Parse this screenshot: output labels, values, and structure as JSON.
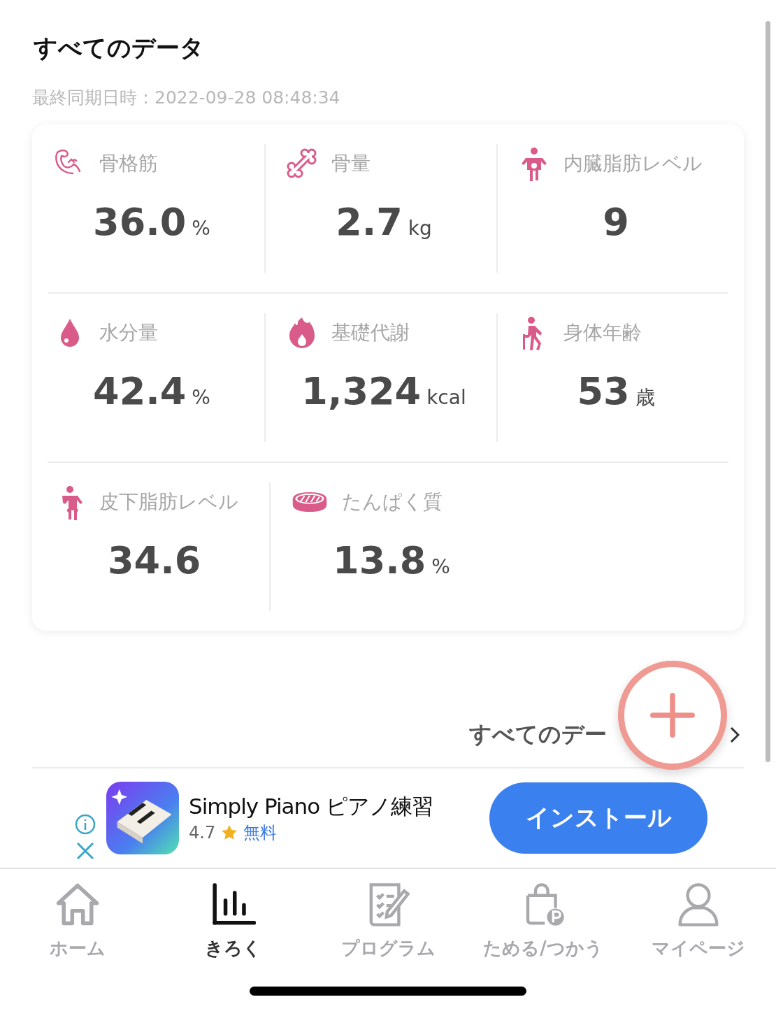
{
  "header": {
    "title": "すべてのデータ",
    "sync": "最終同期日時：2022-09-28 08:48:34"
  },
  "metrics": [
    {
      "kind": "muscle",
      "label": "骨格筋",
      "value": "36.0",
      "unit": "%"
    },
    {
      "kind": "bone",
      "label": "骨量",
      "value": "2.7",
      "unit": "kg"
    },
    {
      "kind": "visceral",
      "label": "内臓脂肪レベル",
      "value": "9"
    },
    {
      "kind": "water",
      "label": "水分量",
      "value": "42.4",
      "unit": "%"
    },
    {
      "kind": "flame",
      "label": "基礎代謝",
      "value": "1,324",
      "unit": "kcal"
    },
    {
      "kind": "age",
      "label": "身体年齢",
      "value": "53",
      "unit": "歳"
    },
    {
      "kind": "subcutaneous",
      "label": "皮下脂肪レベル",
      "value": "34.6"
    },
    {
      "kind": "protein",
      "label": "たんぱく質",
      "value": "13.8",
      "unit": "%"
    }
  ],
  "all_data_link": "すべてのデー",
  "ad": {
    "app_name": "Simply Piano ピアノ練習",
    "rating": "4.7",
    "price": "無料",
    "button": "インストール"
  },
  "tabs": [
    {
      "kind": "home",
      "label": "ホーム",
      "selected": false
    },
    {
      "kind": "chart",
      "label": "きろく",
      "selected": true
    },
    {
      "kind": "program",
      "label": "プログラム",
      "selected": false
    },
    {
      "kind": "bag",
      "label": "ためる/つかう",
      "selected": false
    },
    {
      "kind": "person",
      "label": "マイページ",
      "selected": false
    }
  ]
}
